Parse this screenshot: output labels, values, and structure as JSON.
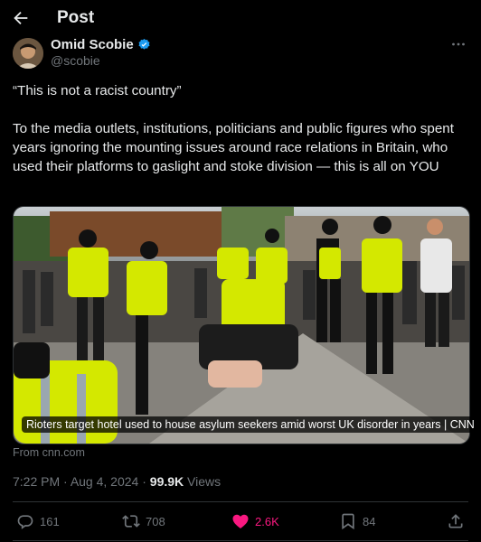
{
  "header": {
    "title": "Post"
  },
  "author": {
    "name": "Omid Scobie",
    "handle": "@scobie"
  },
  "tweet": {
    "paragraphs": [
      "“This is not a racist country”",
      "To the media outlets, institutions, politicians and public figures who spent years ignoring the mounting issues around race relations in Britain, who used their platforms to gaslight and stoke division — this is all on YOU"
    ]
  },
  "media": {
    "caption": "Rioters target hotel used to house asylum seekers amid worst UK disorder in years | CNN",
    "source": "From cnn.com"
  },
  "meta": {
    "time": "7:22 PM",
    "sep1": " · ",
    "date": "Aug 4, 2024",
    "sep2": " · ",
    "views": "99.9K",
    "views_label": " Views"
  },
  "actions": {
    "replies": "161",
    "reposts": "708",
    "likes": "2.6K",
    "bookmarks": "84"
  },
  "colors": {
    "like_active": "#f91880",
    "verified": "#1d9bf0",
    "muted": "#71767b",
    "text": "#e7e9ea"
  },
  "icons": [
    "arrow-left-icon",
    "verified-badge-icon",
    "more-icon",
    "reply-icon",
    "repost-icon",
    "heart-icon",
    "bookmark-icon",
    "share-icon"
  ]
}
